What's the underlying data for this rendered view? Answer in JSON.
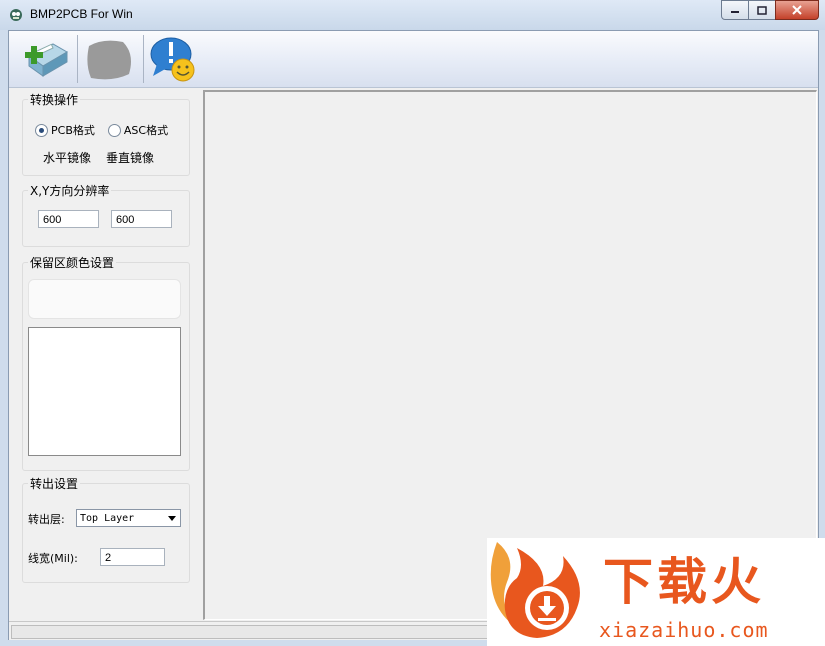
{
  "window": {
    "title": "BMP2PCB For Win"
  },
  "toolbar": {
    "buttons": [
      {
        "icon": "import-icon"
      },
      {
        "icon": "blurred-icon"
      },
      {
        "icon": "about-icon"
      }
    ]
  },
  "convert_group": {
    "legend": "转换操作",
    "radio_pcb": "PCB格式",
    "radio_asc": "ASC格式",
    "selected": "PCB格式",
    "mirror_h": "水平镜像",
    "mirror_v": "垂直镜像"
  },
  "resolution_group": {
    "legend": "X,Y方向分辨率",
    "x_value": "600",
    "y_value": "600"
  },
  "color_group": {
    "legend": "保留区颜色设置"
  },
  "output_group": {
    "legend": "转出设置",
    "layer_label": "转出层:",
    "layer_value": "Top  Layer",
    "width_label": "线宽(Mil):",
    "width_value": "2"
  },
  "watermark": {
    "brand_cn": "下载火",
    "brand_url": "xiazaihuo.com",
    "color": "#e8571e"
  }
}
